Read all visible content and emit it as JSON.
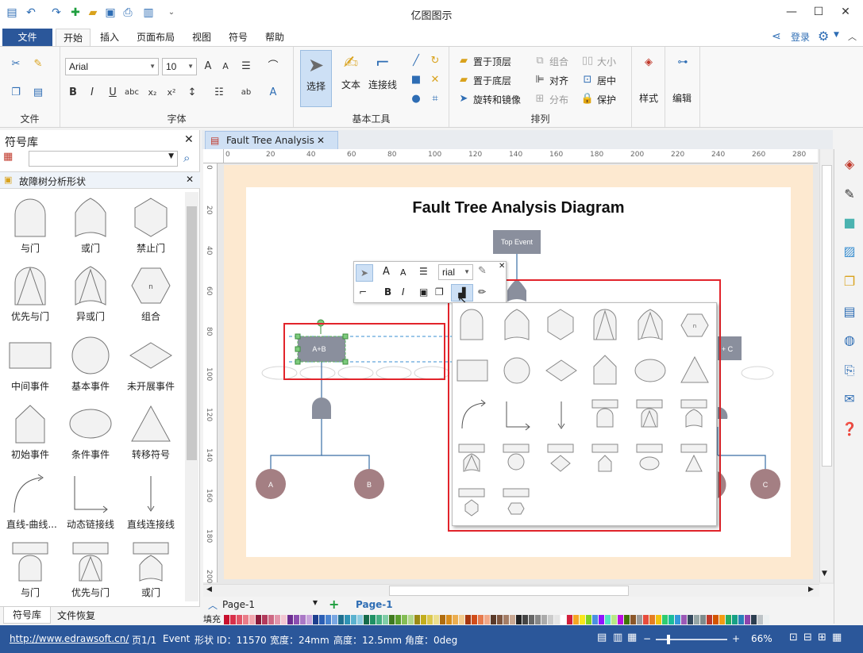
{
  "app": {
    "title": "亿图图示"
  },
  "menu": {
    "file": "文件",
    "tabs": [
      "开始",
      "插入",
      "页面布局",
      "视图",
      "符号",
      "帮助"
    ],
    "login": "登录"
  },
  "ribbon": {
    "groups": {
      "file": "文件",
      "font": "字体",
      "basic_tools": "基本工具",
      "arrange": "排列"
    },
    "font_name": "Arial",
    "font_size": "10",
    "tools": {
      "select": "选择",
      "text": "文本",
      "connector": "连接线"
    },
    "arrange": {
      "bring_front": "置于顶层",
      "send_back": "置于底层",
      "rotate_mirror": "旋转和镜像",
      "group": "组合",
      "align": "对齐",
      "distribute": "分布",
      "size": "大小",
      "center": "居中",
      "protect": "保护"
    },
    "style": "样式",
    "edit": "编辑"
  },
  "library": {
    "title": "符号库",
    "category": "故障树分析形状",
    "shapes": [
      "与门",
      "或门",
      "禁止门",
      "优先与门",
      "异或门",
      "组合",
      "中间事件",
      "基本事件",
      "未开展事件",
      "初始事件",
      "条件事件",
      "转移符号",
      "直线-曲线...",
      "动态链接线",
      "直线连接线",
      "与门",
      "优先与门",
      "或门"
    ],
    "combo_label": "n",
    "bottom_tabs": [
      "符号库",
      "文件恢复"
    ]
  },
  "document": {
    "tab": "Fault Tree Analysis",
    "diagram_title": "Fault Tree Analysis Diagram",
    "nodes": {
      "top": "Top Event",
      "left_event": "A+B",
      "right_event_partial": "+ C",
      "a": "A",
      "b": "B",
      "c": "C"
    },
    "mini_toolbar_font": "rial",
    "popup_combo_label": "n"
  },
  "rulers": {
    "top": [
      "0",
      "20",
      "40",
      "60",
      "80",
      "100",
      "120",
      "140",
      "160",
      "180",
      "200",
      "220",
      "240",
      "260",
      "280"
    ],
    "left": [
      "0",
      "20",
      "40",
      "60",
      "80",
      "100",
      "120",
      "140",
      "160",
      "180",
      "200"
    ]
  },
  "pages": {
    "selector": "Page-1",
    "active": "Page-1"
  },
  "palette": {
    "label": "填充"
  },
  "status": {
    "url": "http://www.edrawsoft.cn/",
    "page": "页1/1",
    "shape_type": "Event",
    "shape_id": "形状 ID：11570",
    "width": "宽度：24mm",
    "height": "高度：12.5mm",
    "angle": "角度：0deg",
    "zoom": "66%"
  },
  "colors": {
    "accent": "#2b579a",
    "node": "#8a8f9d",
    "event_circle": "#a47f83",
    "highlight": "#e2242b",
    "page_bg": "#fde9d0"
  }
}
